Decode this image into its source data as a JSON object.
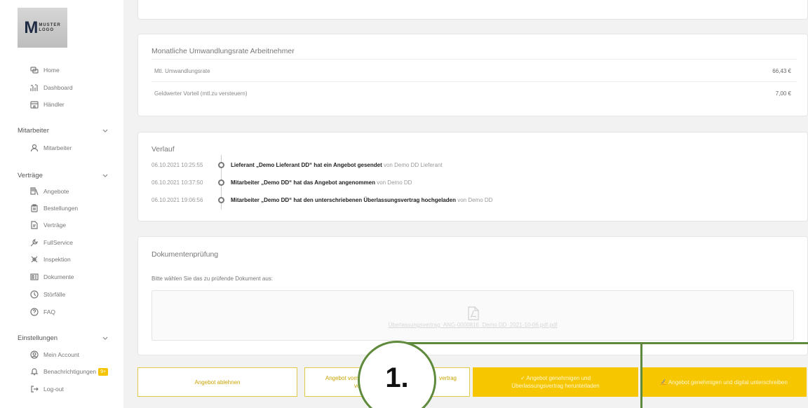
{
  "logo": {
    "letter": "M",
    "line1": "MUSTER",
    "line2": "LOGO"
  },
  "sidebar": {
    "top_items": [
      {
        "label": "Home",
        "icon": "chat-icon"
      },
      {
        "label": "Dashboard",
        "icon": "dashboard-icon"
      },
      {
        "label": "Händler",
        "icon": "store-icon"
      }
    ],
    "sections": {
      "mitarbeiter": {
        "title": "Mitarbeiter",
        "items": [
          {
            "label": "Mitarbeiter",
            "icon": "user-icon"
          }
        ]
      },
      "vertraege": {
        "title": "Verträge",
        "items": [
          {
            "label": "Angebote",
            "icon": "offers-icon"
          },
          {
            "label": "Bestellungen",
            "icon": "clipboard-icon"
          },
          {
            "label": "Verträge",
            "icon": "contract-icon"
          },
          {
            "label": "FullService",
            "icon": "wrench-icon"
          },
          {
            "label": "Inspektion",
            "icon": "inspection-icon"
          },
          {
            "label": "Dokumente",
            "icon": "documents-icon"
          },
          {
            "label": "Störfälle",
            "icon": "clock-icon"
          },
          {
            "label": "FAQ",
            "icon": "help-icon"
          }
        ]
      },
      "einstellungen": {
        "title": "Einstellungen",
        "items": [
          {
            "label": "Mein Account",
            "icon": "account-icon"
          },
          {
            "label": "Benachrichtigungen",
            "icon": "bell-icon",
            "badge": "9+"
          },
          {
            "label": "Log-out",
            "icon": "logout-icon"
          }
        ]
      }
    }
  },
  "umwandlung": {
    "title": "Monatliche Umwandlungsrate Arbeitnehmer",
    "rows": [
      {
        "label": "Mtl. Umwandlungsrate",
        "value": "66,43 €"
      },
      {
        "label": "Geldwerter Vorteil (mtl.zu versteuern)",
        "value": "7,00 €"
      }
    ]
  },
  "verlauf": {
    "title": "Verlauf",
    "entries": [
      {
        "date": "06.10.2021 10:25:55",
        "text": "Lieferant „Demo Lieferant DD“ hat ein Angebot gesendet",
        "by": "von Demo DD Lieferant"
      },
      {
        "date": "06.10.2021 10:37:50",
        "text": "Mitarbeiter „Demo DD“ hat das Angebot angenommen",
        "by": "von Demo DD"
      },
      {
        "date": "06.10.2021 19:06:56",
        "text": "Mitarbeiter „Demo DD“ hat den unterschriebenen Überlassungsvertrag hochgeladen",
        "by": "von Demo DD"
      }
    ]
  },
  "dokumente": {
    "title": "Dokumentenprüfung",
    "instruction": "Bitte wählen Sie das zu prüfende Dokument aus:",
    "file_name": "Überlassungsvertrag_ANG-0000816_Demo DD_2021-10-06.pdf.pdf"
  },
  "actions": {
    "reject": "Angebot ablehnen",
    "middle_left": "Angebot vom",
    "middle_left2": "von",
    "middle_right": "vertrag",
    "approve_download_line1": "✓ Angebot genehmigen und",
    "approve_download_line2": "Überlassungsvertrag herunterladen",
    "approve_sign": "✍ Angebot genehmigen und digital unterschreiben"
  },
  "callout": {
    "label": "1."
  },
  "colors": {
    "accent": "#f6c600",
    "callout": "#5f8a3b"
  }
}
